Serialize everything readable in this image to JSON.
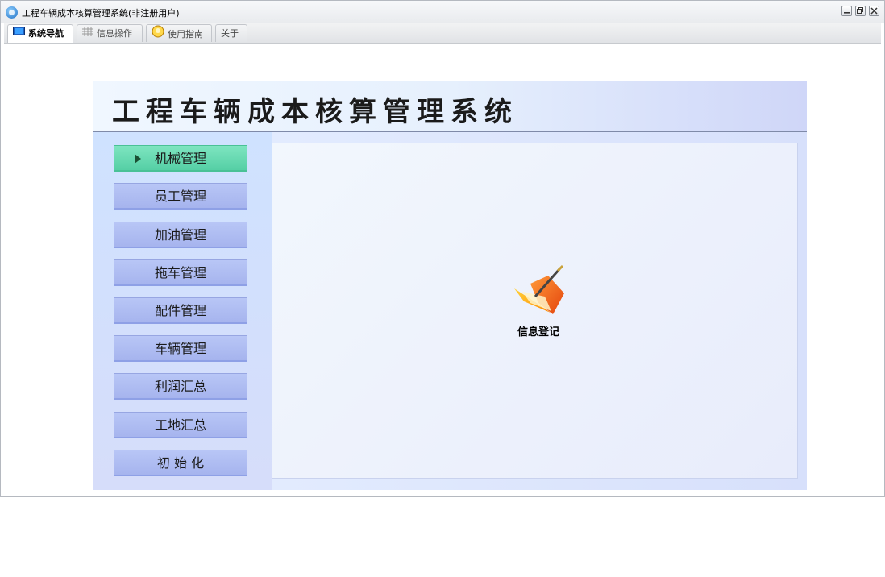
{
  "window": {
    "title": "工程车辆成本核算管理系统(非注册用户)",
    "controls": [
      "minimize",
      "restore",
      "close"
    ]
  },
  "tabs": [
    {
      "label": "系统导航",
      "icon": "monitor-icon",
      "active": true
    },
    {
      "label": "信息操作",
      "icon": "grid-icon",
      "active": false
    },
    {
      "label": "使用指南",
      "icon": "lightbulb-icon",
      "active": false
    },
    {
      "label": "关于",
      "icon": "",
      "active": false
    }
  ],
  "system": {
    "title": "工程车辆成本核算管理系统",
    "nav": [
      {
        "label": "机械管理",
        "active": true
      },
      {
        "label": "员工管理",
        "active": false
      },
      {
        "label": "加油管理",
        "active": false
      },
      {
        "label": "拖车管理",
        "active": false
      },
      {
        "label": "配件管理",
        "active": false
      },
      {
        "label": "车辆管理",
        "active": false
      },
      {
        "label": "利润汇总",
        "active": false
      },
      {
        "label": "工地汇总",
        "active": false
      },
      {
        "label": "初 始 化",
        "active": false
      }
    ],
    "panel_item": {
      "label": "信息登记",
      "icon": "folder-pen-icon"
    }
  },
  "colors": {
    "nav_active": "#55cfa5",
    "nav_normal": "#a6b4ee",
    "banner_bg": "#e6f0fd"
  }
}
